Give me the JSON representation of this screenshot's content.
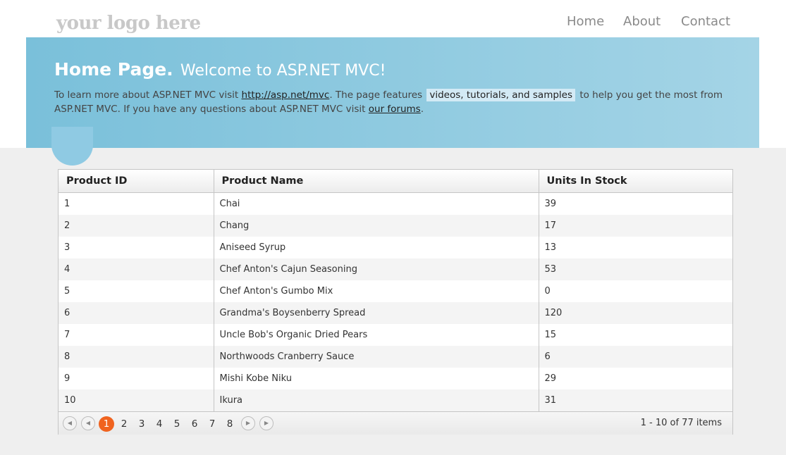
{
  "header": {
    "logo": "your logo here",
    "nav": [
      {
        "label": "Home"
      },
      {
        "label": "About"
      },
      {
        "label": "Contact"
      }
    ]
  },
  "featured": {
    "title_bold": "Home Page.",
    "title_rest": "Welcome to ASP.NET MVC!",
    "p1": "To learn more about ASP.NET MVC visit",
    "link1": "http://asp.net/mvc",
    "p2": ". The page features",
    "highlight": "videos, tutorials, and samples",
    "p3": "to help you get the most from ASP.NET MVC. If you have any questions about ASP.NET MVC visit",
    "link2": "our forums",
    "p4": "."
  },
  "grid": {
    "columns": [
      "Product ID",
      "Product Name",
      "Units In Stock"
    ],
    "rows": [
      [
        "1",
        "Chai",
        "39"
      ],
      [
        "2",
        "Chang",
        "17"
      ],
      [
        "3",
        "Aniseed Syrup",
        "13"
      ],
      [
        "4",
        "Chef Anton's Cajun Seasoning",
        "53"
      ],
      [
        "5",
        "Chef Anton's Gumbo Mix",
        "0"
      ],
      [
        "6",
        "Grandma's Boysenberry Spread",
        "120"
      ],
      [
        "7",
        "Uncle Bob's Organic Dried Pears",
        "15"
      ],
      [
        "8",
        "Northwoods Cranberry Sauce",
        "6"
      ],
      [
        "9",
        "Mishi Kobe Niku",
        "29"
      ],
      [
        "10",
        "Ikura",
        "31"
      ]
    ],
    "pager": {
      "pages": [
        "1",
        "2",
        "3",
        "4",
        "5",
        "6",
        "7",
        "8"
      ],
      "active_page": "1",
      "info": "1 - 10 of 77 items",
      "first_icon": "first-page-icon",
      "prev_icon": "previous-page-icon",
      "next_icon": "next-page-icon",
      "last_icon": "last-page-icon"
    }
  },
  "colors": {
    "featured_start": "#7ac0da",
    "featured_end": "#a4d4e6",
    "active_page": "#f0631f"
  }
}
